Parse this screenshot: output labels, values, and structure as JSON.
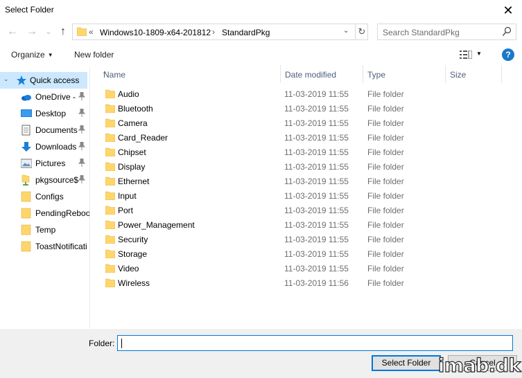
{
  "window": {
    "title": "Select Folder",
    "close_glyph": "✕"
  },
  "nav": {
    "back_glyph": "←",
    "forward_glyph": "→",
    "recent_glyph": "⌄",
    "up_glyph": "↑",
    "address": {
      "overflow": "«",
      "crumbs": [
        "Windows10-1809-x64-201812",
        "StandardPkg"
      ],
      "separator": "›",
      "dropdown_glyph": "⌄",
      "refresh_glyph": "↻"
    },
    "search_placeholder": "Search StandardPkg"
  },
  "toolbar": {
    "organize": "Organize",
    "new_folder": "New folder",
    "help": "?"
  },
  "sidebar": {
    "items": [
      {
        "label": "Quick access",
        "icon": "star-icon",
        "selected": true,
        "expander": "⌄"
      },
      {
        "label": "OneDrive -",
        "icon": "onedrive-icon",
        "pinned": true
      },
      {
        "label": "Desktop",
        "icon": "desktop-icon",
        "pinned": true
      },
      {
        "label": "Documents",
        "icon": "documents-icon",
        "pinned": true
      },
      {
        "label": "Downloads",
        "icon": "downloads-icon",
        "pinned": true
      },
      {
        "label": "Pictures",
        "icon": "pictures-icon",
        "pinned": true
      },
      {
        "label": "pkgsource$",
        "icon": "network-drive-icon",
        "pinned": true
      },
      {
        "label": "Configs",
        "icon": "folder-icon",
        "pinned": false
      },
      {
        "label": "PendingReboo",
        "icon": "folder-icon",
        "pinned": false
      },
      {
        "label": "Temp",
        "icon": "folder-icon",
        "pinned": false
      },
      {
        "label": "ToastNotificati",
        "icon": "folder-icon",
        "pinned": false
      }
    ]
  },
  "columns": {
    "name": "Name",
    "date": "Date modified",
    "type": "Type",
    "size": "Size"
  },
  "files": [
    {
      "name": "Audio",
      "date": "11-03-2019 11:55",
      "type": "File folder"
    },
    {
      "name": "Bluetooth",
      "date": "11-03-2019 11:55",
      "type": "File folder"
    },
    {
      "name": "Camera",
      "date": "11-03-2019 11:55",
      "type": "File folder"
    },
    {
      "name": "Card_Reader",
      "date": "11-03-2019 11:55",
      "type": "File folder"
    },
    {
      "name": "Chipset",
      "date": "11-03-2019 11:55",
      "type": "File folder"
    },
    {
      "name": "Display",
      "date": "11-03-2019 11:55",
      "type": "File folder"
    },
    {
      "name": "Ethernet",
      "date": "11-03-2019 11:55",
      "type": "File folder"
    },
    {
      "name": "Input",
      "date": "11-03-2019 11:55",
      "type": "File folder"
    },
    {
      "name": "Port",
      "date": "11-03-2019 11:55",
      "type": "File folder"
    },
    {
      "name": "Power_Management",
      "date": "11-03-2019 11:55",
      "type": "File folder"
    },
    {
      "name": "Security",
      "date": "11-03-2019 11:55",
      "type": "File folder"
    },
    {
      "name": "Storage",
      "date": "11-03-2019 11:55",
      "type": "File folder"
    },
    {
      "name": "Video",
      "date": "11-03-2019 11:55",
      "type": "File folder"
    },
    {
      "name": "Wireless",
      "date": "11-03-2019 11:56",
      "type": "File folder"
    }
  ],
  "footer": {
    "folder_label": "Folder:",
    "folder_value": "",
    "select_button": "Select Folder",
    "cancel_button": "Cancel"
  },
  "watermark": "imab.dk",
  "colors": {
    "accent": "#0078d7",
    "selection": "#cce8ff",
    "folder": "#ffd66b",
    "header_text": "#4c607a"
  }
}
